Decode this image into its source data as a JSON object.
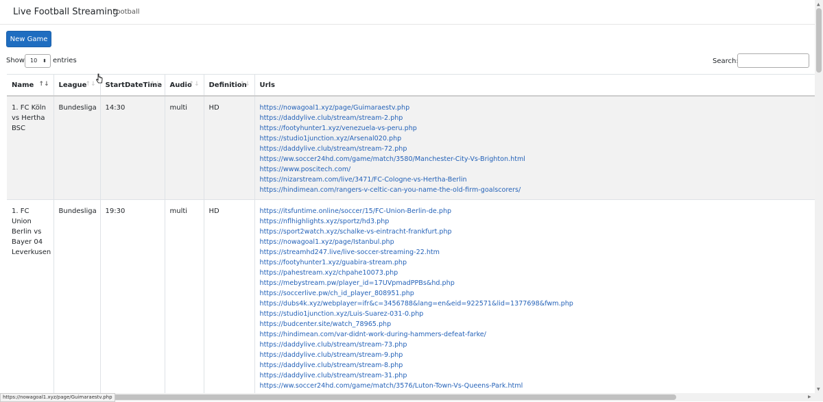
{
  "navbar": {
    "brand": "Live Football Streaming",
    "link": "Football"
  },
  "toolbar": {
    "new_game_label": "New Game"
  },
  "length": {
    "show_label": "Show",
    "selected": "10",
    "entries_label": "entries"
  },
  "search": {
    "label": "Search:",
    "value": ""
  },
  "table": {
    "headers": [
      "Name",
      "League",
      "StartDateTime",
      "Audio",
      "Definition",
      "Urls"
    ],
    "rows": [
      {
        "name": "1. FC Köln vs Hertha BSC",
        "league": "Bundesliga",
        "start": "14:30",
        "audio": "multi",
        "definition": "HD",
        "urls": [
          "https://nowagoal1.xyz/page/Guimaraestv.php",
          "https://daddylive.club/stream/stream-2.php",
          "https://footyhunter1.xyz/venezuela-vs-peru.php",
          "https://studio1junction.xyz/Arsenal020.php",
          "https://daddylive.club/stream/stream-72.php",
          "https://ww.soccer24hd.com/game/match/3580/Manchester-City-Vs-Brighton.html",
          "https://www.poscitech.com/",
          "https://nizarstream.com/live/3471/FC-Cologne-vs-Hertha-Berlin",
          "https://hindimean.com/rangers-v-celtic-can-you-name-the-old-firm-goalscorers/"
        ]
      },
      {
        "name": "1. FC Union Berlin vs Bayer 04 Leverkusen",
        "league": "Bundesliga",
        "start": "19:30",
        "audio": "multi",
        "definition": "HD",
        "urls": [
          "https://itsfuntime.online/soccer/15/FC-Union-Berlin-de.php",
          "https://nflhighlights.xyz/sportz/hd3.php",
          "https://sport2watch.xyz/schalke-vs-eintracht-frankfurt.php",
          "https://nowagoal1.xyz/page/Istanbul.php",
          "https://streamhd247.live/live-soccer-streaming-22.htm",
          "https://footyhunter1.xyz/guabira-stream.php",
          "https://pahestream.xyz/chpahe10073.php",
          "https://mebystream.pw/player_id=17UVpmadPPBs&hd.php",
          "https://soccerlive.pw/ch_id_player_808951.php",
          "https://dubs4k.xyz/webplayer=ifr&c=3456788&lang=en&eid=922571&lid=1377698&fwm.php",
          "https://studio1junction.xyz/Luis-Suarez-031-0.php",
          "https://budcenter.site/watch_78965.php",
          "https://hindimean.com/var-didnt-work-during-hammers-defeat-farke/",
          "https://daddylive.club/stream/stream-73.php",
          "https://daddylive.club/stream/stream-9.php",
          "https://daddylive.club/stream/stream-8.php",
          "https://daddylive.club/stream/stream-31.php",
          "https://ww.soccer24hd.com/game/match/3576/Luton-Town-Vs-Queens-Park.html"
        ]
      }
    ]
  },
  "statusbar": {
    "url": "https://nowagoal1.xyz/page/Guimaraestv.php"
  },
  "icons": {
    "sort": "sort-arrows-icon",
    "select": "chevron-updown-icon",
    "cursor": "mouse-pointer-icon"
  }
}
